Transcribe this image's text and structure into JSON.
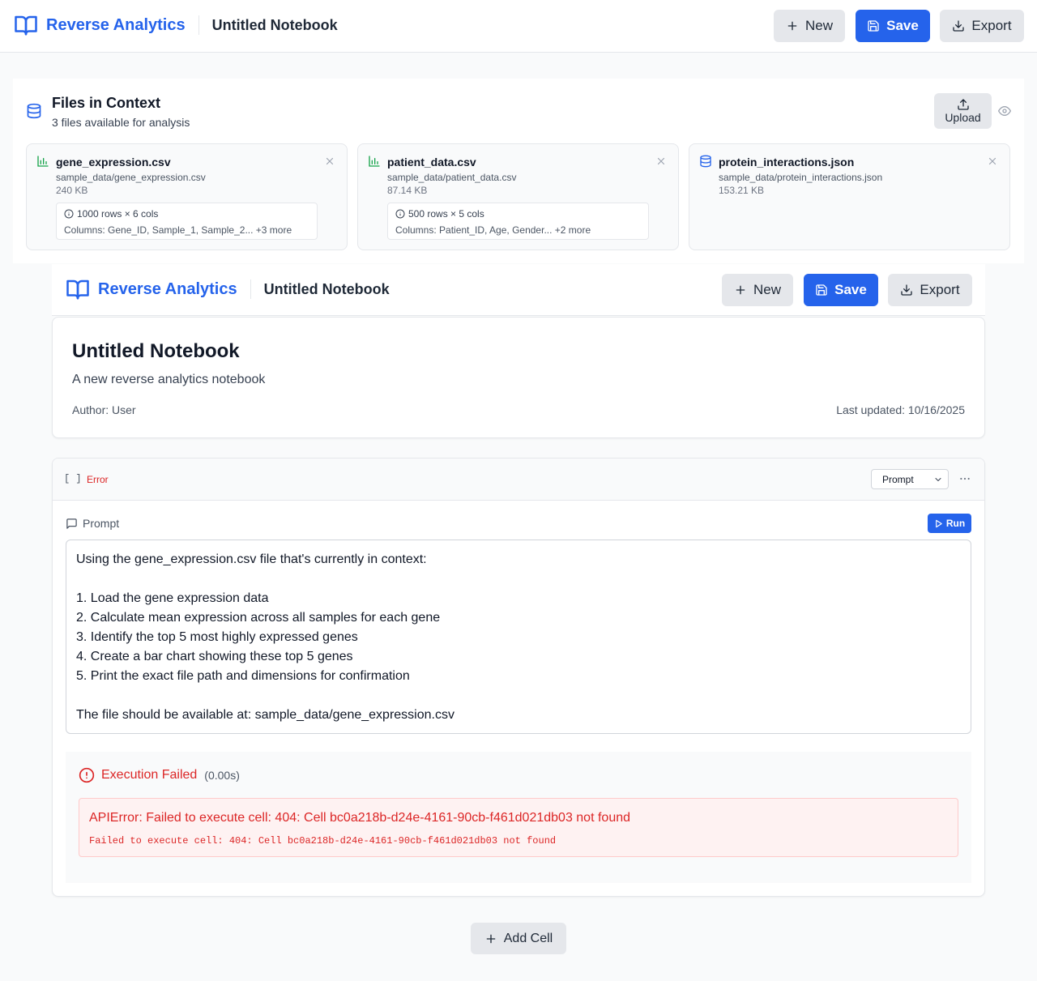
{
  "app": {
    "brand": "Reverse Analytics",
    "notebook_title": "Untitled Notebook",
    "actions": {
      "new_label": "New",
      "save_label": "Save",
      "export_label": "Export"
    }
  },
  "files": {
    "title": "Files in Context",
    "subtitle": "3 files available for analysis",
    "upload_label": "Upload",
    "items": [
      {
        "name": "gene_expression.csv",
        "path": "sample_data/gene_expression.csv",
        "size": "240 KB",
        "type_icon": "chart-icon",
        "shape": "1000 rows × 6 cols",
        "columns": "Columns: Gene_ID, Sample_1, Sample_2... +3 more"
      },
      {
        "name": "patient_data.csv",
        "path": "sample_data/patient_data.csv",
        "size": "87.14 KB",
        "type_icon": "chart-icon",
        "shape": "500 rows × 5 cols",
        "columns": "Columns: Patient_ID, Age, Gender... +2 more"
      },
      {
        "name": "protein_interactions.json",
        "path": "sample_data/protein_interactions.json",
        "size": "153.21 KB",
        "type_icon": "database-icon"
      }
    ]
  },
  "notebook": {
    "title": "Untitled Notebook",
    "description": "A new reverse analytics notebook",
    "author": "Author: User",
    "last_updated": "Last updated: 10/16/2025"
  },
  "cell": {
    "bracket": "[ ]",
    "status": "Error",
    "type_selected": "Prompt",
    "prompt_label": "Prompt",
    "run_label": "Run",
    "prompt_text": "Using the gene_expression.csv file that's currently in context:\n\n1. Load the gene expression data\n2. Calculate mean expression across all samples for each gene\n3. Identify the top 5 most highly expressed genes\n4. Create a bar chart showing these top 5 genes\n5. Print the exact file path and dimensions for confirmation\n\nThe file should be available at: sample_data/gene_expression.csv",
    "error": {
      "title": "Execution Failed",
      "time": "(0.00s)",
      "message": "APIError: Failed to execute cell: 404: Cell bc0a218b-d24e-4161-90cb-f461d021db03 not found",
      "detail": "Failed to execute cell: 404: Cell bc0a218b-d24e-4161-90cb-f461d021db03 not found"
    }
  },
  "add_cell_label": "Add Cell",
  "colors": {
    "primary": "#2563eb",
    "error": "#dc2626",
    "success": "#16a34a"
  }
}
